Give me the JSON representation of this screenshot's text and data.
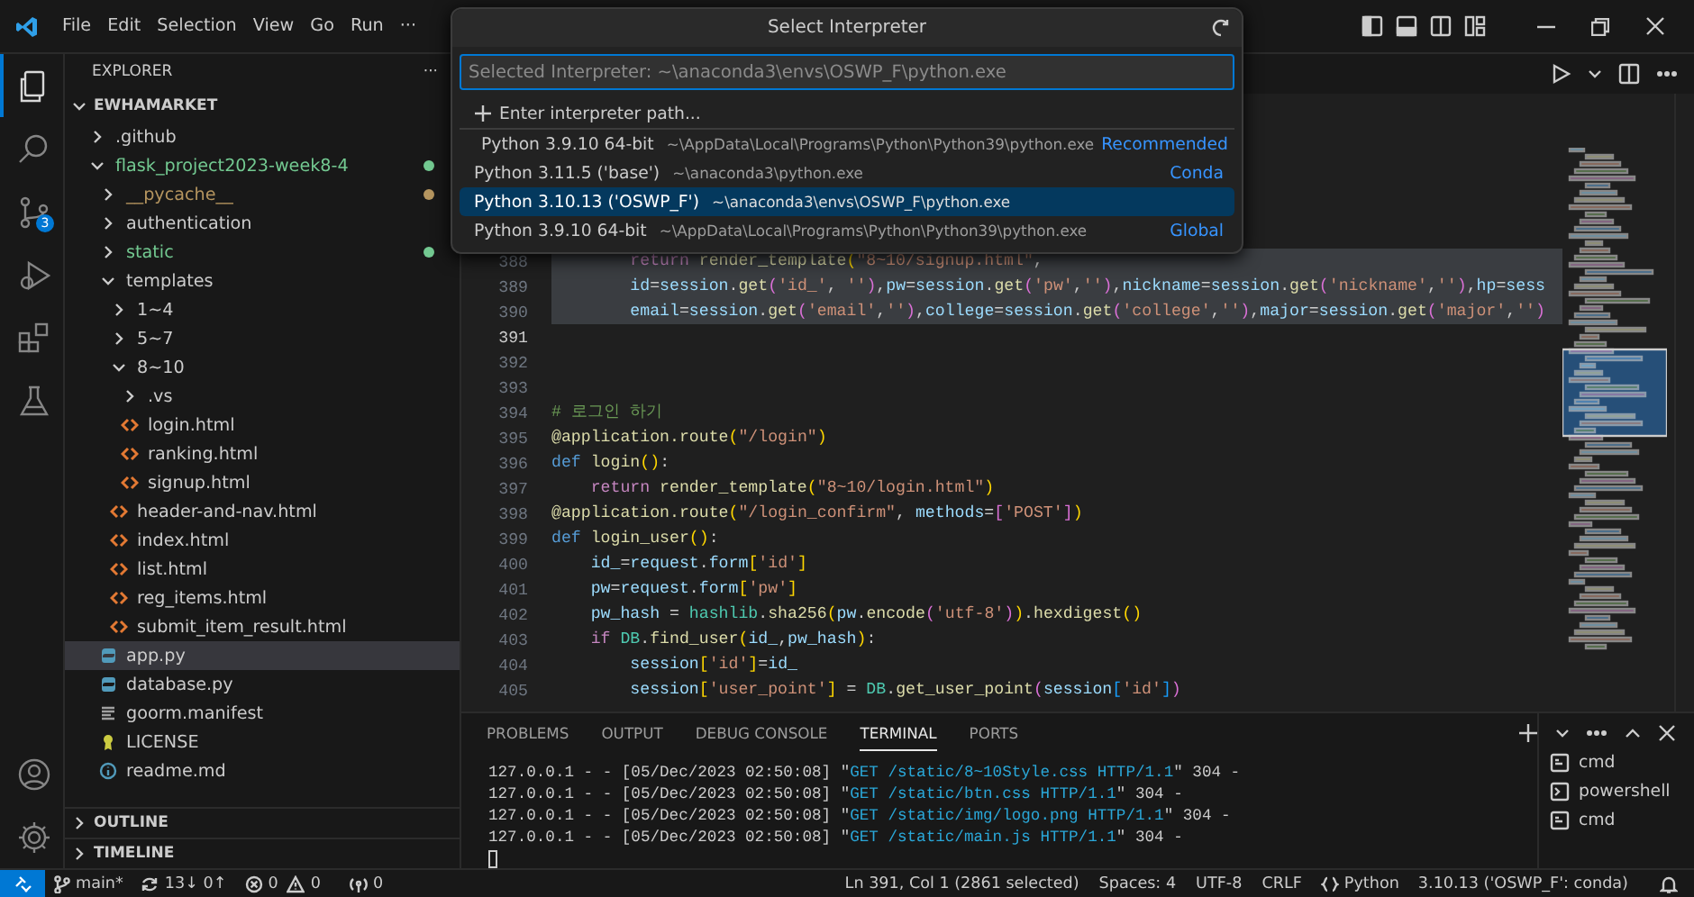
{
  "title_bar": {
    "menu": [
      "File",
      "Edit",
      "Selection",
      "View",
      "Go",
      "Run",
      "···"
    ]
  },
  "activity_bar": {
    "top": [
      {
        "kind": "explorer",
        "selected": true
      },
      {
        "kind": "search",
        "selected": false
      },
      {
        "kind": "scm",
        "selected": false,
        "badge": "3"
      },
      {
        "kind": "debug",
        "selected": false
      },
      {
        "kind": "extensions",
        "selected": false
      },
      {
        "kind": "testing",
        "selected": false
      }
    ],
    "bottom": [
      {
        "kind": "account"
      },
      {
        "kind": "settings"
      }
    ]
  },
  "sidebar": {
    "title": "EXPLORER",
    "more": "···",
    "root": {
      "label": "EWHAMARKET",
      "expanded": true
    },
    "items": [
      {
        "label": ".github",
        "kind": "folder",
        "expanded": false,
        "selected": false
      },
      {
        "label": "flask_project2023-week8-4",
        "kind": "folder",
        "expanded": true,
        "selected": false,
        "color": "#73c991",
        "children": [
          {
            "label": "__pycache__",
            "kind": "folder",
            "expanded": false,
            "selected": false,
            "color": "#b5955f"
          },
          {
            "label": "authentication",
            "kind": "folder",
            "expanded": false,
            "selected": false
          },
          {
            "label": "static",
            "kind": "folder",
            "expanded": false,
            "selected": false,
            "color": "#73c991"
          },
          {
            "label": "templates",
            "kind": "folder",
            "expanded": true,
            "selected": false,
            "children": [
              {
                "label": "1~4",
                "kind": "folder",
                "expanded": false,
                "selected": false
              },
              {
                "label": "5~7",
                "kind": "folder",
                "expanded": false,
                "selected": false
              },
              {
                "label": "8~10",
                "kind": "folder",
                "expanded": true,
                "selected": false,
                "children": [
                  {
                    "label": ".vs",
                    "kind": "folder",
                    "expanded": false,
                    "selected": false
                  },
                  {
                    "label": "login.html",
                    "kind": "html",
                    "selected": false
                  },
                  {
                    "label": "ranking.html",
                    "kind": "html",
                    "selected": false
                  },
                  {
                    "label": "signup.html",
                    "kind": "html",
                    "selected": false
                  }
                ]
              },
              {
                "label": "header-and-nav.html",
                "kind": "html",
                "selected": false
              },
              {
                "label": "index.html",
                "kind": "html",
                "selected": false
              },
              {
                "label": "list.html",
                "kind": "html",
                "selected": false
              },
              {
                "label": "reg_items.html",
                "kind": "html",
                "selected": false
              },
              {
                "label": "submit_item_result.html",
                "kind": "html",
                "selected": false
              }
            ]
          },
          {
            "label": "app.py",
            "kind": "python",
            "selected": true
          },
          {
            "label": "database.py",
            "kind": "python",
            "selected": false
          },
          {
            "label": "goorm.manifest",
            "kind": "manifest",
            "selected": false
          },
          {
            "label": "LICENSE",
            "kind": "license",
            "selected": false
          },
          {
            "label": "readme.md",
            "kind": "info",
            "selected": false
          }
        ]
      }
    ],
    "sections": [
      {
        "label": "OUTLINE",
        "expanded": false
      },
      {
        "label": "TIMELINE",
        "expanded": false
      }
    ]
  },
  "editor": {
    "lines": [
      {
        "number": "388",
        "selected": true,
        "current": false,
        "tokens": [
          {
            "kind": "ctl",
            "text": "        return "
          },
          {
            "kind": "fn",
            "text": "render_template"
          },
          {
            "kind": "b1",
            "text": "("
          },
          {
            "kind": "str",
            "text": "\"8~10/signup.html\""
          },
          {
            "kind": "p",
            "text": ","
          }
        ]
      },
      {
        "number": "389",
        "selected": true,
        "current": false,
        "tokens": [
          {
            "kind": "var",
            "text": "        id"
          },
          {
            "kind": "p",
            "text": "="
          },
          {
            "kind": "var",
            "text": "session"
          },
          {
            "kind": "p",
            "text": "."
          },
          {
            "kind": "fn",
            "text": "get"
          },
          {
            "kind": "b2",
            "text": "("
          },
          {
            "kind": "str",
            "text": "'id_'"
          },
          {
            "kind": "p",
            "text": ", "
          },
          {
            "kind": "str",
            "text": "''"
          },
          {
            "kind": "b2",
            "text": ")"
          },
          {
            "kind": "p",
            "text": ","
          },
          {
            "kind": "var",
            "text": "pw"
          },
          {
            "kind": "p",
            "text": "="
          },
          {
            "kind": "var",
            "text": "session"
          },
          {
            "kind": "p",
            "text": "."
          },
          {
            "kind": "fn",
            "text": "get"
          },
          {
            "kind": "b2",
            "text": "("
          },
          {
            "kind": "str",
            "text": "'pw'"
          },
          {
            "kind": "p",
            "text": ","
          },
          {
            "kind": "str",
            "text": "''"
          },
          {
            "kind": "b2",
            "text": ")"
          },
          {
            "kind": "p",
            "text": ","
          },
          {
            "kind": "var",
            "text": "nickname"
          },
          {
            "kind": "p",
            "text": "="
          },
          {
            "kind": "var",
            "text": "session"
          },
          {
            "kind": "p",
            "text": "."
          },
          {
            "kind": "fn",
            "text": "get"
          },
          {
            "kind": "b2",
            "text": "("
          },
          {
            "kind": "str",
            "text": "'nickname'"
          },
          {
            "kind": "p",
            "text": ","
          },
          {
            "kind": "str",
            "text": "''"
          },
          {
            "kind": "b2",
            "text": ")"
          },
          {
            "kind": "p",
            "text": ","
          },
          {
            "kind": "var",
            "text": "hp"
          },
          {
            "kind": "p",
            "text": "="
          },
          {
            "kind": "var",
            "text": "sess"
          }
        ]
      },
      {
        "number": "390",
        "selected": true,
        "current": false,
        "tokens": [
          {
            "kind": "var",
            "text": "        email"
          },
          {
            "kind": "p",
            "text": "="
          },
          {
            "kind": "var",
            "text": "session"
          },
          {
            "kind": "p",
            "text": "."
          },
          {
            "kind": "fn",
            "text": "get"
          },
          {
            "kind": "b2",
            "text": "("
          },
          {
            "kind": "str",
            "text": "'email'"
          },
          {
            "kind": "p",
            "text": ","
          },
          {
            "kind": "str",
            "text": "''"
          },
          {
            "kind": "b2",
            "text": ")"
          },
          {
            "kind": "p",
            "text": ","
          },
          {
            "kind": "var",
            "text": "college"
          },
          {
            "kind": "p",
            "text": "="
          },
          {
            "kind": "var",
            "text": "session"
          },
          {
            "kind": "p",
            "text": "."
          },
          {
            "kind": "fn",
            "text": "get"
          },
          {
            "kind": "b2",
            "text": "("
          },
          {
            "kind": "str",
            "text": "'college'"
          },
          {
            "kind": "p",
            "text": ","
          },
          {
            "kind": "str",
            "text": "''"
          },
          {
            "kind": "b2",
            "text": ")"
          },
          {
            "kind": "p",
            "text": ","
          },
          {
            "kind": "var",
            "text": "major"
          },
          {
            "kind": "p",
            "text": "="
          },
          {
            "kind": "var",
            "text": "session"
          },
          {
            "kind": "p",
            "text": "."
          },
          {
            "kind": "fn",
            "text": "get"
          },
          {
            "kind": "b2",
            "text": "("
          },
          {
            "kind": "str",
            "text": "'major'"
          },
          {
            "kind": "p",
            "text": ","
          },
          {
            "kind": "str",
            "text": "''"
          },
          {
            "kind": "b2",
            "text": ")"
          }
        ]
      },
      {
        "number": "391",
        "selected": false,
        "current": true
      },
      {
        "number": "392",
        "selected": false,
        "current": false
      },
      {
        "number": "393",
        "selected": false,
        "current": false
      },
      {
        "number": "394",
        "selected": false,
        "current": false,
        "tokens": [
          {
            "kind": "cm",
            "text": "# 로그인 하기"
          }
        ]
      },
      {
        "number": "395",
        "selected": false,
        "current": false,
        "tokens": [
          {
            "kind": "fn",
            "text": "@application.route"
          },
          {
            "kind": "b1",
            "text": "("
          },
          {
            "kind": "str",
            "text": "\"/login\""
          },
          {
            "kind": "b1",
            "text": ")"
          }
        ]
      },
      {
        "number": "396",
        "selected": false,
        "current": false,
        "tokens": [
          {
            "kind": "def",
            "text": "def "
          },
          {
            "kind": "fn",
            "text": "login"
          },
          {
            "kind": "b1",
            "text": "()"
          },
          {
            "kind": "p",
            "text": ":"
          }
        ]
      },
      {
        "number": "397",
        "selected": false,
        "current": false,
        "tokens": [
          {
            "kind": "ctl",
            "text": "    return "
          },
          {
            "kind": "fn",
            "text": "render_template"
          },
          {
            "kind": "b1",
            "text": "("
          },
          {
            "kind": "str",
            "text": "\"8~10/login.html\""
          },
          {
            "kind": "b1",
            "text": ")"
          }
        ]
      },
      {
        "number": "398",
        "selected": false,
        "current": false,
        "tokens": [
          {
            "kind": "fn",
            "text": "@application.route"
          },
          {
            "kind": "b1",
            "text": "("
          },
          {
            "kind": "str",
            "text": "\"/login_confirm\""
          },
          {
            "kind": "p",
            "text": ", "
          },
          {
            "kind": "var",
            "text": "methods"
          },
          {
            "kind": "p",
            "text": "="
          },
          {
            "kind": "b2",
            "text": "["
          },
          {
            "kind": "str",
            "text": "'POST'"
          },
          {
            "kind": "b2",
            "text": "]"
          },
          {
            "kind": "b1",
            "text": ")"
          }
        ]
      },
      {
        "number": "399",
        "selected": false,
        "current": false,
        "tokens": [
          {
            "kind": "def",
            "text": "def "
          },
          {
            "kind": "fn",
            "text": "login_user"
          },
          {
            "kind": "b1",
            "text": "()"
          },
          {
            "kind": "p",
            "text": ":"
          }
        ]
      },
      {
        "number": "400",
        "selected": false,
        "current": false,
        "tokens": [
          {
            "kind": "var",
            "text": "    id_"
          },
          {
            "kind": "p",
            "text": "="
          },
          {
            "kind": "var",
            "text": "request"
          },
          {
            "kind": "p",
            "text": "."
          },
          {
            "kind": "var",
            "text": "form"
          },
          {
            "kind": "b1",
            "text": "["
          },
          {
            "kind": "str",
            "text": "'id'"
          },
          {
            "kind": "b1",
            "text": "]"
          }
        ]
      },
      {
        "number": "401",
        "selected": false,
        "current": false,
        "tokens": [
          {
            "kind": "var",
            "text": "    pw"
          },
          {
            "kind": "p",
            "text": "="
          },
          {
            "kind": "var",
            "text": "request"
          },
          {
            "kind": "p",
            "text": "."
          },
          {
            "kind": "var",
            "text": "form"
          },
          {
            "kind": "b1",
            "text": "["
          },
          {
            "kind": "str",
            "text": "'pw'"
          },
          {
            "kind": "b1",
            "text": "]"
          }
        ]
      },
      {
        "number": "402",
        "selected": false,
        "current": false,
        "tokens": [
          {
            "kind": "var",
            "text": "    pw_hash"
          },
          {
            "kind": "p",
            "text": " = "
          },
          {
            "kind": "cls",
            "text": "hashlib"
          },
          {
            "kind": "p",
            "text": "."
          },
          {
            "kind": "fn",
            "text": "sha256"
          },
          {
            "kind": "b1",
            "text": "("
          },
          {
            "kind": "var",
            "text": "pw"
          },
          {
            "kind": "p",
            "text": "."
          },
          {
            "kind": "fn",
            "text": "encode"
          },
          {
            "kind": "b2",
            "text": "("
          },
          {
            "kind": "str",
            "text": "'utf-8'"
          },
          {
            "kind": "b2",
            "text": ")"
          },
          {
            "kind": "b1",
            "text": ")"
          },
          {
            "kind": "p",
            "text": "."
          },
          {
            "kind": "fn",
            "text": "hexdigest"
          },
          {
            "kind": "b1",
            "text": "()"
          }
        ]
      },
      {
        "number": "403",
        "selected": false,
        "current": false,
        "tokens": [
          {
            "kind": "ctl",
            "text": "    if "
          },
          {
            "kind": "cls",
            "text": "DB"
          },
          {
            "kind": "p",
            "text": "."
          },
          {
            "kind": "fn",
            "text": "find_user"
          },
          {
            "kind": "b1",
            "text": "("
          },
          {
            "kind": "var",
            "text": "id_"
          },
          {
            "kind": "p",
            "text": ","
          },
          {
            "kind": "var",
            "text": "pw_hash"
          },
          {
            "kind": "b1",
            "text": ")"
          },
          {
            "kind": "p",
            "text": ":"
          }
        ]
      },
      {
        "number": "404",
        "selected": false,
        "current": false,
        "tokens": [
          {
            "kind": "var",
            "text": "        session"
          },
          {
            "kind": "b1",
            "text": "["
          },
          {
            "kind": "str",
            "text": "'id'"
          },
          {
            "kind": "b1",
            "text": "]"
          },
          {
            "kind": "p",
            "text": "="
          },
          {
            "kind": "var",
            "text": "id_"
          }
        ]
      },
      {
        "number": "405",
        "selected": false,
        "current": false,
        "tokens": [
          {
            "kind": "var",
            "text": "        session"
          },
          {
            "kind": "b1",
            "text": "["
          },
          {
            "kind": "str",
            "text": "'user_point'"
          },
          {
            "kind": "b1",
            "text": "]"
          },
          {
            "kind": "p",
            "text": " = "
          },
          {
            "kind": "cls",
            "text": "DB"
          },
          {
            "kind": "p",
            "text": "."
          },
          {
            "kind": "fn",
            "text": "get_user_point"
          },
          {
            "kind": "b2",
            "text": "("
          },
          {
            "kind": "var",
            "text": "session"
          },
          {
            "kind": "b3",
            "text": "["
          },
          {
            "kind": "str",
            "text": "'id'"
          },
          {
            "kind": "b3",
            "text": "]"
          },
          {
            "kind": "b2",
            "text": ")"
          }
        ]
      }
    ]
  },
  "panel": {
    "tabs": [
      {
        "label": "PROBLEMS",
        "selected": false
      },
      {
        "label": "OUTPUT",
        "selected": false
      },
      {
        "label": "DEBUG CONSOLE",
        "selected": false
      },
      {
        "label": "TERMINAL",
        "selected": true
      },
      {
        "label": "PORTS",
        "selected": false
      }
    ],
    "terminal_lines": [
      [
        {
          "kind": "p",
          "text": "127.0.0.1 - - [05/Dec/2023 02:50:08] \""
        },
        {
          "kind": "req",
          "text": "GET /static/8~10Style.css HTTP/1.1"
        },
        {
          "kind": "p",
          "text": "\" 304 -"
        }
      ],
      [
        {
          "kind": "p",
          "text": "127.0.0.1 - - [05/Dec/2023 02:50:08] \""
        },
        {
          "kind": "req",
          "text": "GET /static/btn.css HTTP/1.1"
        },
        {
          "kind": "p",
          "text": "\" 304 -"
        }
      ],
      [
        {
          "kind": "p",
          "text": "127.0.0.1 - - [05/Dec/2023 02:50:08] \""
        },
        {
          "kind": "req",
          "text": "GET /static/img/logo.png HTTP/1.1"
        },
        {
          "kind": "p",
          "text": "\" 304 -"
        }
      ],
      [
        {
          "kind": "p",
          "text": "127.0.0.1 - - [05/Dec/2023 02:50:08] \""
        },
        {
          "kind": "req",
          "text": "GET /static/main.js HTTP/1.1"
        },
        {
          "kind": "p",
          "text": "\" 304 -"
        }
      ]
    ],
    "terminals": [
      {
        "label": "cmd",
        "kind": "cmd"
      },
      {
        "label": "powershell",
        "kind": "powershell"
      },
      {
        "label": "cmd",
        "kind": "cmd"
      }
    ]
  },
  "quick_pick": {
    "title": "Select Interpreter",
    "placeholder": "Selected Interpreter: ~\\anaconda3\\envs\\OSWP_F\\python.exe",
    "items": [
      {
        "kind": "action",
        "label": "Enter interpreter path...",
        "selected": false
      },
      {
        "kind": "recommended",
        "label": "Python 3.9.10 64-bit",
        "description": "~\\AppData\\Local\\Programs\\Python\\Python39\\python.exe",
        "tag": "Recommended",
        "selected": false
      },
      {
        "kind": "interpreter",
        "label": "Python 3.11.5 ('base')",
        "description": "~\\anaconda3\\python.exe",
        "tag": "Conda",
        "selected": false
      },
      {
        "kind": "interpreter",
        "label": "Python 3.10.13 ('OSWP_F')",
        "description": "~\\anaconda3\\envs\\OSWP_F\\python.exe",
        "selected": true
      },
      {
        "kind": "interpreter",
        "label": "Python 3.9.10 64-bit",
        "description": "~\\AppData\\Local\\Programs\\Python\\Python39\\python.exe",
        "tag": "Global",
        "selected": false
      }
    ]
  },
  "status_bar": {
    "left": [
      {
        "kind": "remote"
      },
      {
        "kind": "branch",
        "text": "main*"
      },
      {
        "kind": "sync",
        "text": "13↓ 0↑"
      },
      {
        "kind": "errors",
        "text": "0"
      },
      {
        "kind": "warnings",
        "text": "0"
      },
      {
        "kind": "ports",
        "text": "0"
      }
    ],
    "right": [
      {
        "kind": "text",
        "text": "Ln 391, Col 1 (2861 selected)"
      },
      {
        "kind": "text",
        "text": "Spaces: 4"
      },
      {
        "kind": "text",
        "text": "UTF-8"
      },
      {
        "kind": "text",
        "text": "CRLF"
      },
      {
        "kind": "language",
        "text": "Python"
      },
      {
        "kind": "text",
        "text": "3.10.13 ('OSWP_F': conda)"
      },
      {
        "kind": "bell"
      }
    ]
  }
}
